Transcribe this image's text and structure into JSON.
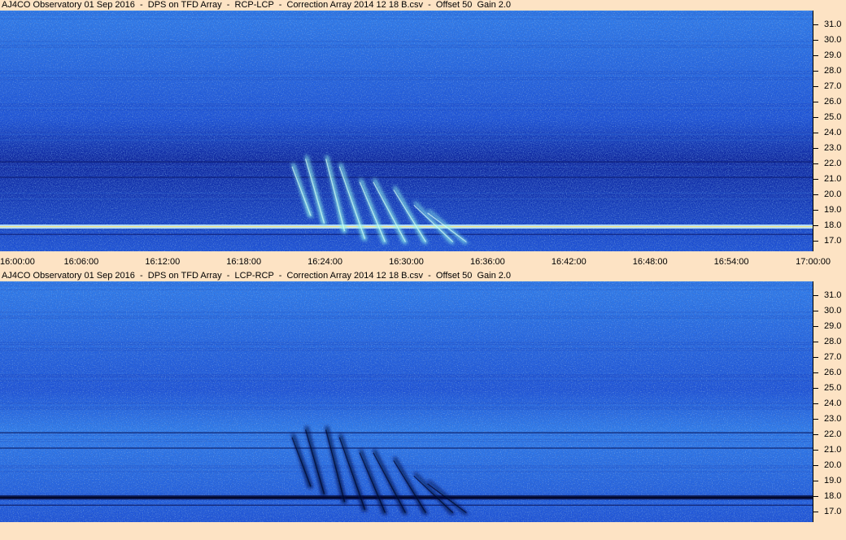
{
  "background": "#fde3c4",
  "chart_data": [
    {
      "type": "heatmap",
      "title": "AJ4CO Observatory 01 Sep 2016  -  DPS on TFD Array  -  RCP-LCP  -  Correction Array 2014 12 18 B.csv  -  Offset 50  Gain 2.0",
      "x_ticks": [
        "16:00:00",
        "16:06:00",
        "16:12:00",
        "16:18:00",
        "16:24:00",
        "16:30:00",
        "16:36:00",
        "16:42:00",
        "16:48:00",
        "16:54:00",
        "17:00:00"
      ],
      "x_range": [
        "16:00:00",
        "17:00:00"
      ],
      "y_ticks": [
        "31.0",
        "30.0",
        "29.0",
        "28.0",
        "27.0",
        "26.0",
        "25.0",
        "24.0",
        "23.0",
        "22.0",
        "21.0",
        "20.0",
        "19.0",
        "18.0",
        "17.0"
      ],
      "ylim": [
        16.3,
        31.9
      ],
      "colormap": [
        "#0a1f9a",
        "#1a4fd8",
        "#2e7ff0",
        "#5ec8f0",
        "#ffffff"
      ],
      "polarity": "bright",
      "features": {
        "bursts": [
          {
            "start": "16:21:30",
            "end": "16:23:00",
            "freq_high": 22.0,
            "freq_low": 18.5
          },
          {
            "start": "16:22:30",
            "end": "16:24:00",
            "freq_high": 22.5,
            "freq_low": 18.0
          },
          {
            "start": "16:24:00",
            "end": "16:25:30",
            "freq_high": 22.5,
            "freq_low": 17.5
          },
          {
            "start": "16:25:00",
            "end": "16:27:00",
            "freq_high": 22.0,
            "freq_low": 17.0
          },
          {
            "start": "16:26:30",
            "end": "16:28:30",
            "freq_high": 21.0,
            "freq_low": 16.8
          },
          {
            "start": "16:27:30",
            "end": "16:30:00",
            "freq_high": 21.0,
            "freq_low": 16.8
          },
          {
            "start": "16:29:00",
            "end": "16:31:30",
            "freq_high": 20.5,
            "freq_low": 16.8
          },
          {
            "start": "16:30:30",
            "end": "16:33:30",
            "freq_high": 19.5,
            "freq_low": 16.8
          },
          {
            "start": "16:31:30",
            "end": "16:34:30",
            "freq_high": 19.0,
            "freq_low": 16.8
          }
        ],
        "interference_freqs": [
          17.9,
          22.1,
          21.1,
          17.4
        ]
      }
    },
    {
      "type": "heatmap",
      "title": "AJ4CO Observatory 01 Sep 2016  -  DPS on TFD Array  -  LCP-RCP  -  Correction Array 2014 12 18 B.csv  -  Offset 50  Gain 2.0",
      "x_ticks": [],
      "x_range": [
        "16:00:00",
        "17:00:00"
      ],
      "y_ticks": [
        "31.0",
        "30.0",
        "29.0",
        "28.0",
        "27.0",
        "26.0",
        "25.0",
        "24.0",
        "23.0",
        "22.0",
        "21.0",
        "20.0",
        "19.0",
        "18.0",
        "17.0"
      ],
      "ylim": [
        16.3,
        31.9
      ],
      "colormap": [
        "#0a1f9a",
        "#1a4fd8",
        "#2e7ff0",
        "#5ec8f0",
        "#ffffff"
      ],
      "polarity": "dark",
      "features": {
        "bursts": [
          {
            "start": "16:21:30",
            "end": "16:23:00",
            "freq_high": 22.0,
            "freq_low": 18.5
          },
          {
            "start": "16:22:30",
            "end": "16:24:00",
            "freq_high": 22.5,
            "freq_low": 18.0
          },
          {
            "start": "16:24:00",
            "end": "16:25:30",
            "freq_high": 22.5,
            "freq_low": 17.5
          },
          {
            "start": "16:25:00",
            "end": "16:27:00",
            "freq_high": 22.0,
            "freq_low": 17.0
          },
          {
            "start": "16:26:30",
            "end": "16:28:30",
            "freq_high": 21.0,
            "freq_low": 16.8
          },
          {
            "start": "16:27:30",
            "end": "16:30:00",
            "freq_high": 21.0,
            "freq_low": 16.8
          },
          {
            "start": "16:29:00",
            "end": "16:31:30",
            "freq_high": 20.5,
            "freq_low": 16.8
          },
          {
            "start": "16:30:30",
            "end": "16:33:30",
            "freq_high": 19.5,
            "freq_low": 16.8
          },
          {
            "start": "16:31:30",
            "end": "16:34:30",
            "freq_high": 19.0,
            "freq_low": 16.8
          }
        ],
        "interference_freqs": [
          17.9,
          22.1,
          21.1,
          17.4
        ]
      }
    }
  ]
}
